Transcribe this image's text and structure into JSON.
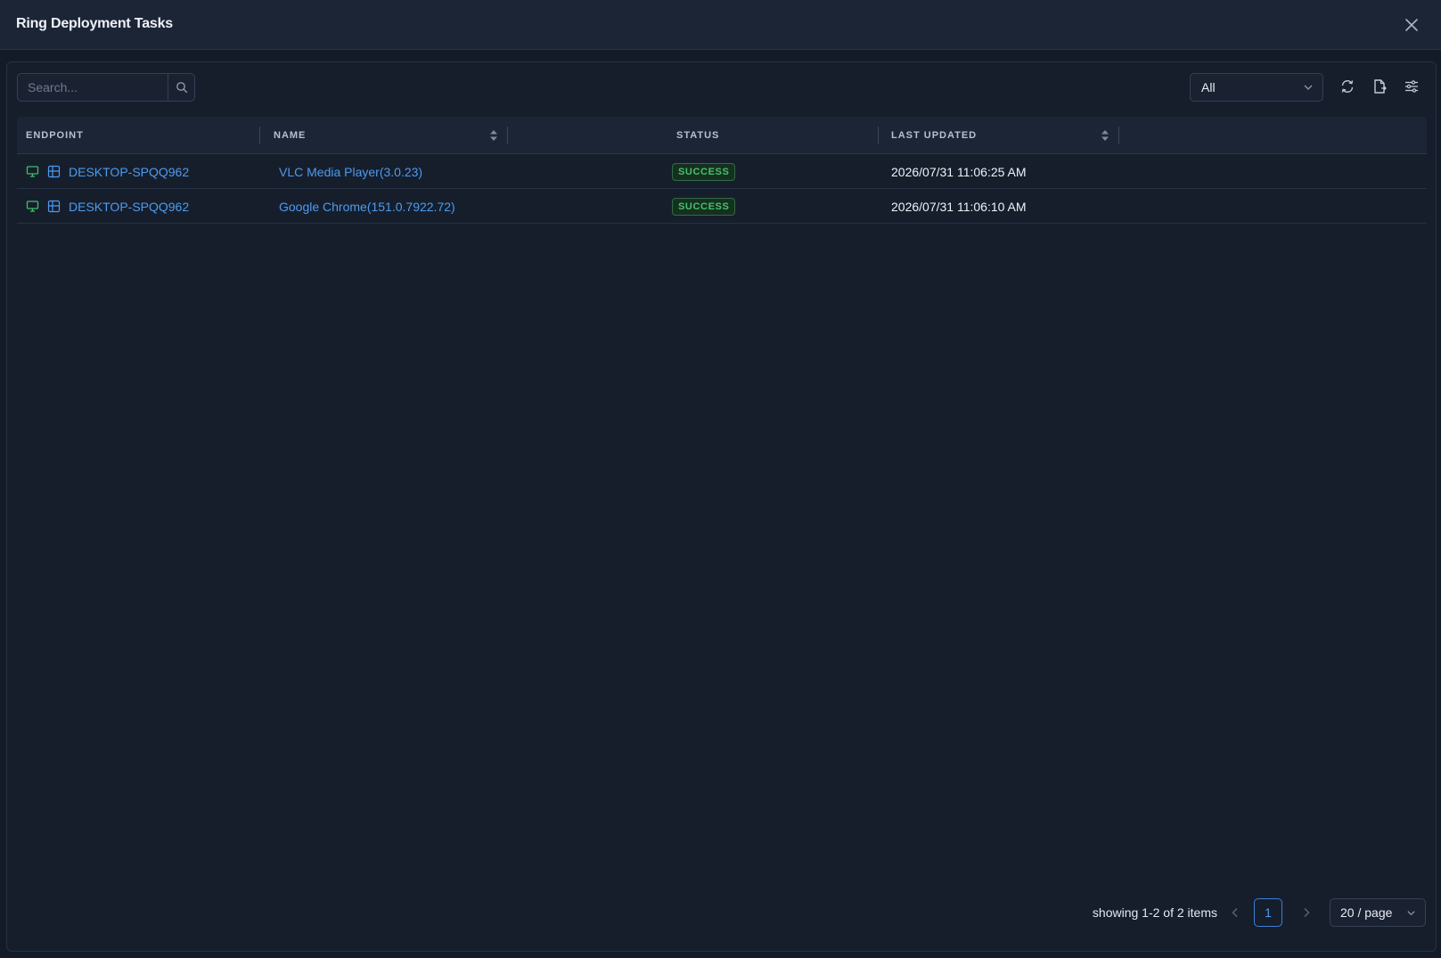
{
  "header": {
    "title": "Ring Deployment Tasks",
    "close_icon": "close-icon"
  },
  "toolbar": {
    "search_placeholder": "Search...",
    "filter_selected": "All",
    "icons": [
      "refresh-icon",
      "export-icon",
      "column-settings-icon"
    ]
  },
  "table": {
    "columns": [
      "ENDPOINT",
      "NAME",
      "STATUS",
      "LAST UPDATED"
    ],
    "rows": [
      {
        "endpoint": "DESKTOP-SPQQ962",
        "name": "VLC Media Player(3.0.23)",
        "status": "SUCCESS",
        "last_updated": "2026/07/31 11:06:25 AM"
      },
      {
        "endpoint": "DESKTOP-SPQQ962",
        "name": "Google Chrome(151.0.7922.72)",
        "status": "SUCCESS",
        "last_updated": "2026/07/31 11:06:10 AM"
      }
    ]
  },
  "pagination": {
    "summary": "showing 1-2 of 2 items",
    "current_page": "1",
    "page_size": "20 / page"
  },
  "colors": {
    "accent": "#4c9bf0",
    "success": "#44c26d",
    "background": "#161e2c"
  }
}
